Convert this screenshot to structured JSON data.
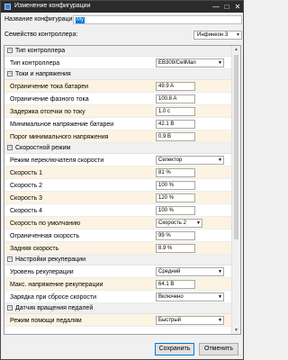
{
  "window": {
    "title": "Изменение конфигурации"
  },
  "name_field": {
    "label": "Название конфигурации:",
    "value": "My"
  },
  "family": {
    "label": "Семейство контроллера:",
    "value": "Инфинеон 3"
  },
  "sections": [
    {
      "title": "Тип контроллера",
      "rows": [
        {
          "label": "Тип контроллера",
          "value": "EB309/CellMan",
          "kind": "combo"
        }
      ]
    },
    {
      "title": "Токи и напряжения",
      "rows": [
        {
          "label": "Ограничение тока батареи",
          "value": "49.9 A",
          "kind": "text"
        },
        {
          "label": "Ограничение фазного тока",
          "value": "100.8 A",
          "kind": "text"
        },
        {
          "label": "Задержка отсечки по току",
          "value": "1.0 c",
          "kind": "text"
        },
        {
          "label": "Минимальное напряжение батареи",
          "value": "42.1 B",
          "kind": "text"
        },
        {
          "label": "Порог минимального напряжения",
          "value": "0.9 B",
          "kind": "text"
        }
      ]
    },
    {
      "title": "Скоростной режим",
      "rows": [
        {
          "label": "Режим переключателя скорости",
          "value": "Селектор",
          "kind": "combo"
        },
        {
          "label": "Скорость 1",
          "value": "81 %",
          "kind": "text"
        },
        {
          "label": "Скорость 2",
          "value": "100 %",
          "kind": "text"
        },
        {
          "label": "Скорость 3",
          "value": "120 %",
          "kind": "text"
        },
        {
          "label": "Скорость 4",
          "value": "100 %",
          "kind": "text"
        },
        {
          "label": "Скорость по умолчанию",
          "value": "Скорость 2",
          "kind": "combo-narrow"
        },
        {
          "label": "Ограниченная скорость",
          "value": "99 %",
          "kind": "text"
        },
        {
          "label": "Задняя скорость",
          "value": "8.9 %",
          "kind": "text"
        }
      ]
    },
    {
      "title": "Настройки рекуперации",
      "rows": [
        {
          "label": "Уровень рекуперации",
          "value": "Средний",
          "kind": "combo"
        },
        {
          "label": "Макс. напряжение рекуперации",
          "value": "64.1 B",
          "kind": "text"
        },
        {
          "label": "Зарядка при сбросе скорости",
          "value": "Включено",
          "kind": "combo"
        }
      ]
    },
    {
      "title": "Датчик вращения педалей",
      "rows": [
        {
          "label": "Режим помощи педалям",
          "value": "Быстрый",
          "kind": "combo"
        }
      ]
    }
  ],
  "buttons": {
    "save": "Сохранить",
    "cancel": "Отменить"
  },
  "colors": {
    "titlebar": "#2b2b2b",
    "selection": "#0078d7",
    "alt_row": "#fdf3e3"
  }
}
